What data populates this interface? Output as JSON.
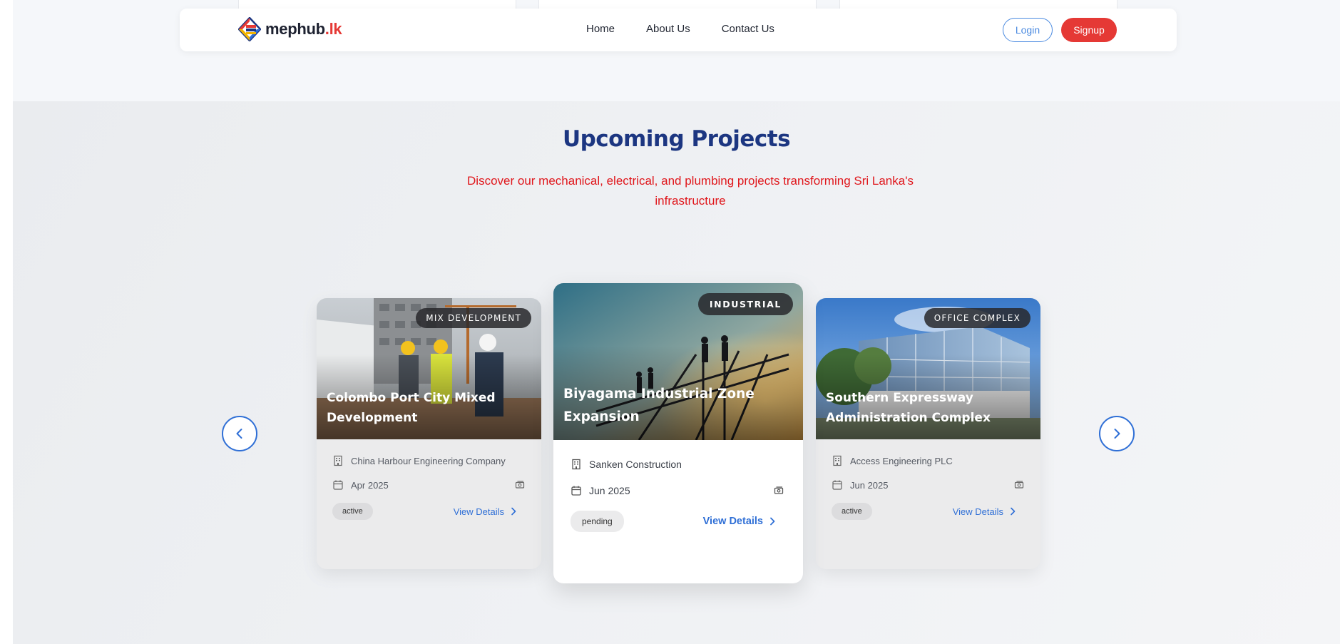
{
  "brand": {
    "name": "mephub",
    "tld": ".lk",
    "accent": "#e53935",
    "primary": "#1c3681",
    "link": "#2f6fd6"
  },
  "nav": {
    "links": [
      "Home",
      "About Us",
      "Contact Us"
    ],
    "login_label": "Login",
    "signup_label": "Signup"
  },
  "section": {
    "title": "Upcoming Projects",
    "subtitle": "Discover our mechanical, electrical, and plumbing projects transforming Sri Lanka's infrastructure"
  },
  "carousel": {
    "prev_icon": "chevron-left-icon",
    "next_icon": "chevron-right-icon",
    "cards": [
      {
        "category": "MIX DEVELOPMENT",
        "title": "Colombo Port City Mixed Development",
        "company": "China Harbour Engineering Company",
        "date": "Apr 2025",
        "status": "active",
        "link_label": "View Details"
      },
      {
        "category": "INDUSTRIAL",
        "title": "Biyagama Industrial Zone Expansion",
        "company": "Sanken Construction",
        "date": "Jun 2025",
        "status": "pending",
        "link_label": "View Details"
      },
      {
        "category": "OFFICE COMPLEX",
        "title": "Southern Expressway Administration Complex",
        "company": "Access Engineering PLC",
        "date": "Jun 2025",
        "status": "active",
        "link_label": "View Details"
      }
    ]
  }
}
